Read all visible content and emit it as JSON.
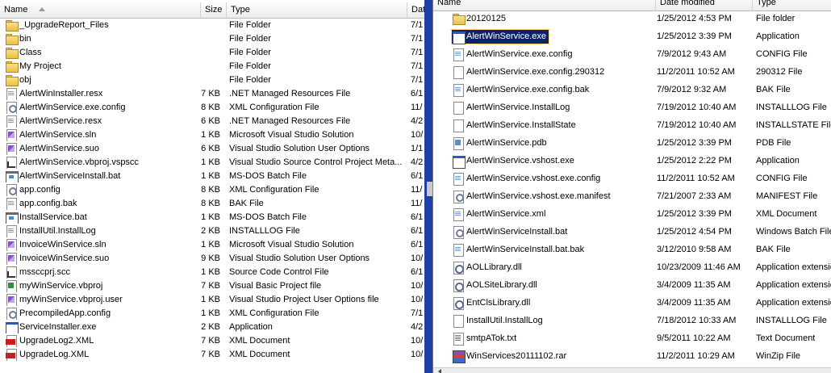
{
  "left": {
    "headers": {
      "name": "Name",
      "size": "Size",
      "type": "Type",
      "date": "Dat"
    },
    "rows": [
      {
        "name": "_UpgradeReport_Files",
        "size": "",
        "type": "File Folder",
        "date": "7/1",
        "icon": "folder"
      },
      {
        "name": "bin",
        "size": "",
        "type": "File Folder",
        "date": "7/1",
        "icon": "folder"
      },
      {
        "name": "Class",
        "size": "",
        "type": "File Folder",
        "date": "7/1",
        "icon": "folder"
      },
      {
        "name": "My Project",
        "size": "",
        "type": "File Folder",
        "date": "7/1",
        "icon": "folder"
      },
      {
        "name": "obj",
        "size": "",
        "type": "File Folder",
        "date": "7/1",
        "icon": "folder"
      },
      {
        "name": "AlertWinInstaller.resx",
        "size": "7 KB",
        "type": ".NET Managed Resources File",
        "date": "6/1",
        "icon": "doc"
      },
      {
        "name": "AlertWinService.exe.config",
        "size": "8 KB",
        "type": "XML Configuration File",
        "date": "11/",
        "icon": "gear"
      },
      {
        "name": "AlertWinService.resx",
        "size": "6 KB",
        "type": ".NET Managed Resources File",
        "date": "4/2",
        "icon": "doc"
      },
      {
        "name": "AlertWinService.sln",
        "size": "1 KB",
        "type": "Microsoft Visual Studio Solution",
        "date": "10/",
        "icon": "sln"
      },
      {
        "name": "AlertWinService.suo",
        "size": "26 KB",
        "type": "Visual Studio Solution User Options",
        "date": "1/1",
        "icon": "sln"
      },
      {
        "name": "AlertWinService.vbproj.vspscc",
        "size": "1 KB",
        "type": "Visual Studio Source Control Project Meta...",
        "date": "4/2",
        "icon": "shortcut"
      },
      {
        "name": "AlertWinServiceInstall.bat",
        "size": "1 KB",
        "type": "MS-DOS Batch File",
        "date": "6/1",
        "icon": "bat"
      },
      {
        "name": "app.config",
        "size": "8 KB",
        "type": "XML Configuration File",
        "date": "11/",
        "icon": "gear"
      },
      {
        "name": "app.config.bak",
        "size": "8 KB",
        "type": "BAK File",
        "date": "11/",
        "icon": "doc"
      },
      {
        "name": "InstallService.bat",
        "size": "1 KB",
        "type": "MS-DOS Batch File",
        "date": "6/1",
        "icon": "bat"
      },
      {
        "name": "InstallUtil.InstallLog",
        "size": "2 KB",
        "type": "INSTALLLOG File",
        "date": "6/1",
        "icon": "doc"
      },
      {
        "name": "InvoiceWinService.sln",
        "size": "1 KB",
        "type": "Microsoft Visual Studio Solution",
        "date": "6/1",
        "icon": "sln"
      },
      {
        "name": "InvoiceWinService.suo",
        "size": "9 KB",
        "type": "Visual Studio Solution User Options",
        "date": "10/",
        "icon": "sln"
      },
      {
        "name": "mssccprj.scc",
        "size": "1 KB",
        "type": "Source Code Control File",
        "date": "6/1",
        "icon": "shortcut"
      },
      {
        "name": "myWinService.vbproj",
        "size": "7 KB",
        "type": "Visual Basic Project file",
        "date": "10/",
        "icon": "code"
      },
      {
        "name": "myWinService.vbproj.user",
        "size": "1 KB",
        "type": "Visual Studio Project User Options file",
        "date": "10/",
        "icon": "sln"
      },
      {
        "name": "PrecompiledApp.config",
        "size": "1 KB",
        "type": "XML Configuration File",
        "date": "7/1",
        "icon": "gear"
      },
      {
        "name": "ServiceInstaller.exe",
        "size": "32 KB",
        "type": "Application",
        "date": "4/2",
        "icon": "app"
      },
      {
        "name": "UpgradeLog2.XML",
        "size": "7 KB",
        "type": "XML Document",
        "date": "10/",
        "icon": "xmlred"
      },
      {
        "name": "UpgradeLog.XML",
        "size": "7 KB",
        "type": "XML Document",
        "date": "10/",
        "icon": "xmlred"
      }
    ]
  },
  "right": {
    "headers": {
      "name": "Name",
      "date": "Date modified",
      "type": "Type"
    },
    "rows": [
      {
        "name": "20120125",
        "date": "1/25/2012 4:53 PM",
        "type": "File folder",
        "icon": "folder"
      },
      {
        "name": "AlertWinService.exe",
        "date": "1/25/2012 3:39 PM",
        "type": "Application",
        "icon": "app",
        "selected": true
      },
      {
        "name": "AlertWinService.exe.config",
        "date": "7/9/2012 9:43 AM",
        "type": "CONFIG File",
        "icon": "doc"
      },
      {
        "name": "AlertWinService.exe.config.290312",
        "date": "11/2/2011 10:52 AM",
        "type": "290312 File",
        "icon": "blank"
      },
      {
        "name": "AlertWinService.exe.config.bak",
        "date": "7/9/2012 9:32 AM",
        "type": "BAK File",
        "icon": "doc"
      },
      {
        "name": "AlertWinService.InstallLog",
        "date": "7/19/2012 10:40 AM",
        "type": "INSTALLLOG File",
        "icon": "blank"
      },
      {
        "name": "AlertWinService.InstallState",
        "date": "7/19/2012 10:40 AM",
        "type": "INSTALLSTATE File",
        "icon": "blank"
      },
      {
        "name": "AlertWinService.pdb",
        "date": "1/25/2012 3:39 PM",
        "type": "PDB File",
        "icon": "pdb"
      },
      {
        "name": "AlertWinService.vshost.exe",
        "date": "1/25/2012 2:22 PM",
        "type": "Application",
        "icon": "app"
      },
      {
        "name": "AlertWinService.vshost.exe.config",
        "date": "11/2/2011 10:52 AM",
        "type": "CONFIG File",
        "icon": "doc"
      },
      {
        "name": "AlertWinService.vshost.exe.manifest",
        "date": "7/21/2007 2:33 AM",
        "type": "MANIFEST File",
        "icon": "gear"
      },
      {
        "name": "AlertWinService.xml",
        "date": "1/25/2012 3:39 PM",
        "type": "XML Document",
        "icon": "doc"
      },
      {
        "name": "AlertWinServiceInstall.bat",
        "date": "1/25/2012 4:54 PM",
        "type": "Windows Batch File",
        "icon": "gear"
      },
      {
        "name": "AlertWinServiceInstall.bat.bak",
        "date": "3/12/2010 9:58 AM",
        "type": "BAK File",
        "icon": "doc"
      },
      {
        "name": "AOLLibrary.dll",
        "date": "10/23/2009 11:46 AM",
        "type": "Application extensio",
        "icon": "dll"
      },
      {
        "name": "AOLSiteLibrary.dll",
        "date": "3/4/2009 11:35 AM",
        "type": "Application extensio",
        "icon": "dll"
      },
      {
        "name": "EntClsLibrary.dll",
        "date": "3/4/2009 11:35 AM",
        "type": "Application extensio",
        "icon": "dll"
      },
      {
        "name": "InstallUtil.InstallLog",
        "date": "7/18/2012 10:33 AM",
        "type": "INSTALLLOG File",
        "icon": "blank"
      },
      {
        "name": "smtpATok.txt",
        "date": "9/5/2011 10:22 AM",
        "type": "Text Document",
        "icon": "txt"
      },
      {
        "name": "WinServices20111102.rar",
        "date": "11/2/2011 10:29 AM",
        "type": "WinZip File",
        "icon": "rar"
      }
    ]
  }
}
